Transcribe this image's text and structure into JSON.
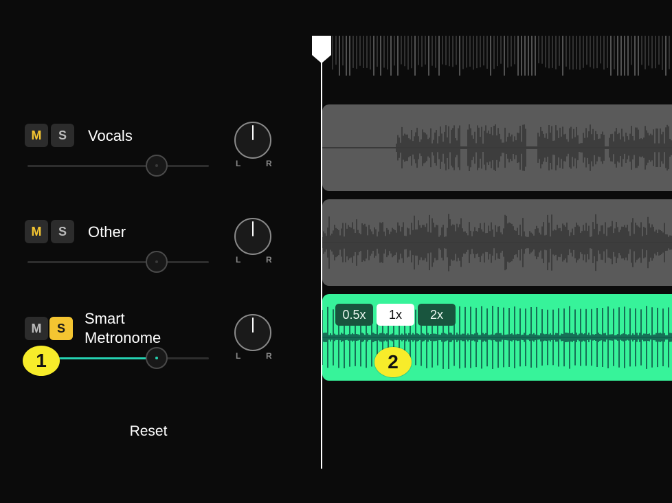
{
  "tracks": [
    {
      "name": "Vocals",
      "mute_label": "M",
      "solo_label": "S",
      "mute_on": true,
      "solo_on": false,
      "volume": 0.72,
      "pan": 0.0
    },
    {
      "name": "Other",
      "mute_label": "M",
      "solo_label": "S",
      "mute_on": true,
      "solo_on": false,
      "volume": 0.72,
      "pan": 0.0
    },
    {
      "name": "Smart\nMetronome",
      "name_line1": "Smart",
      "name_line2": "Metronome",
      "mute_label": "M",
      "solo_label": "S",
      "mute_on": false,
      "solo_on": true,
      "volume": 0.72,
      "pan": 0.0
    }
  ],
  "pan_labels": {
    "left": "L",
    "right": "R"
  },
  "reset_label": "Reset",
  "annotations": {
    "first": "1",
    "second": "2"
  },
  "speed": {
    "options": [
      "0.5x",
      "1x",
      "2x"
    ],
    "selected": "1x"
  },
  "colors": {
    "background": "#0b0b0b",
    "accent_yellow": "#f4c531",
    "accent_teal": "#25d3b2",
    "metronome_lane": "#37f39a",
    "lane_gray": "#5a5a5a"
  },
  "icons": [
    "playhead-marker-icon",
    "pan-knob-icon"
  ]
}
